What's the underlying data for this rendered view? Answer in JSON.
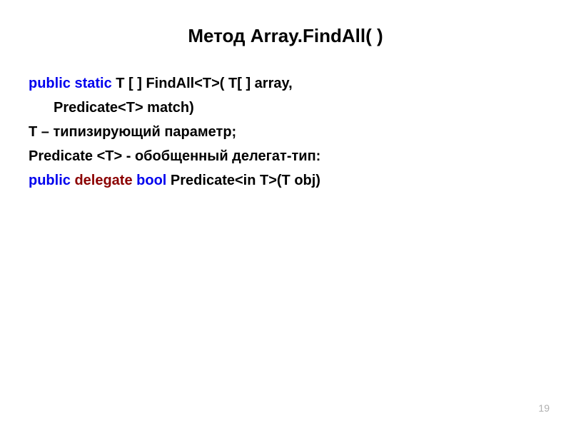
{
  "title": "Метод Array.FindAll( )",
  "line1": {
    "kw": "public static",
    "rest": " T [ ] FindAll<T>( T[ ] array,"
  },
  "line2": "Predicate<T> match)",
  "line3": "T – типизирующий параметр;",
  "line4": "Predicate <T> - обобщенный делегат-тип:",
  "line5": {
    "kw1": "public",
    "kw2": " delegate ",
    "kw3": "bool",
    "rest": " Predicate<in T>(T obj)"
  },
  "pageNumber": "19"
}
